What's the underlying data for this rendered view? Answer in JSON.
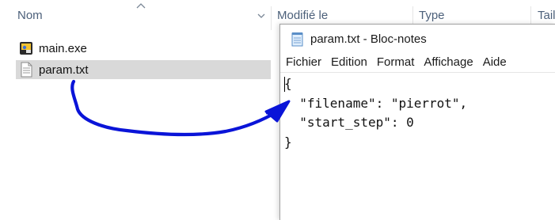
{
  "explorer": {
    "columns": {
      "name": "Nom",
      "modified": "Modifié le",
      "type": "Type",
      "size": "Tail"
    },
    "files": [
      {
        "name": "main.exe",
        "icon": "exe-app-icon",
        "selected": false
      },
      {
        "name": "param.txt",
        "icon": "text-file-icon",
        "selected": true
      }
    ]
  },
  "notepad": {
    "title": "param.txt - Bloc-notes",
    "menu": [
      "Fichier",
      "Edition",
      "Format",
      "Affichage",
      "Aide"
    ],
    "content": "{\n  \"filename\": \"pierrot\",\n  \"start_step\": 0\n}"
  },
  "annotation": {
    "arrow_color": "#0a14d8",
    "from": "param.txt",
    "to": "notepad-editor"
  }
}
